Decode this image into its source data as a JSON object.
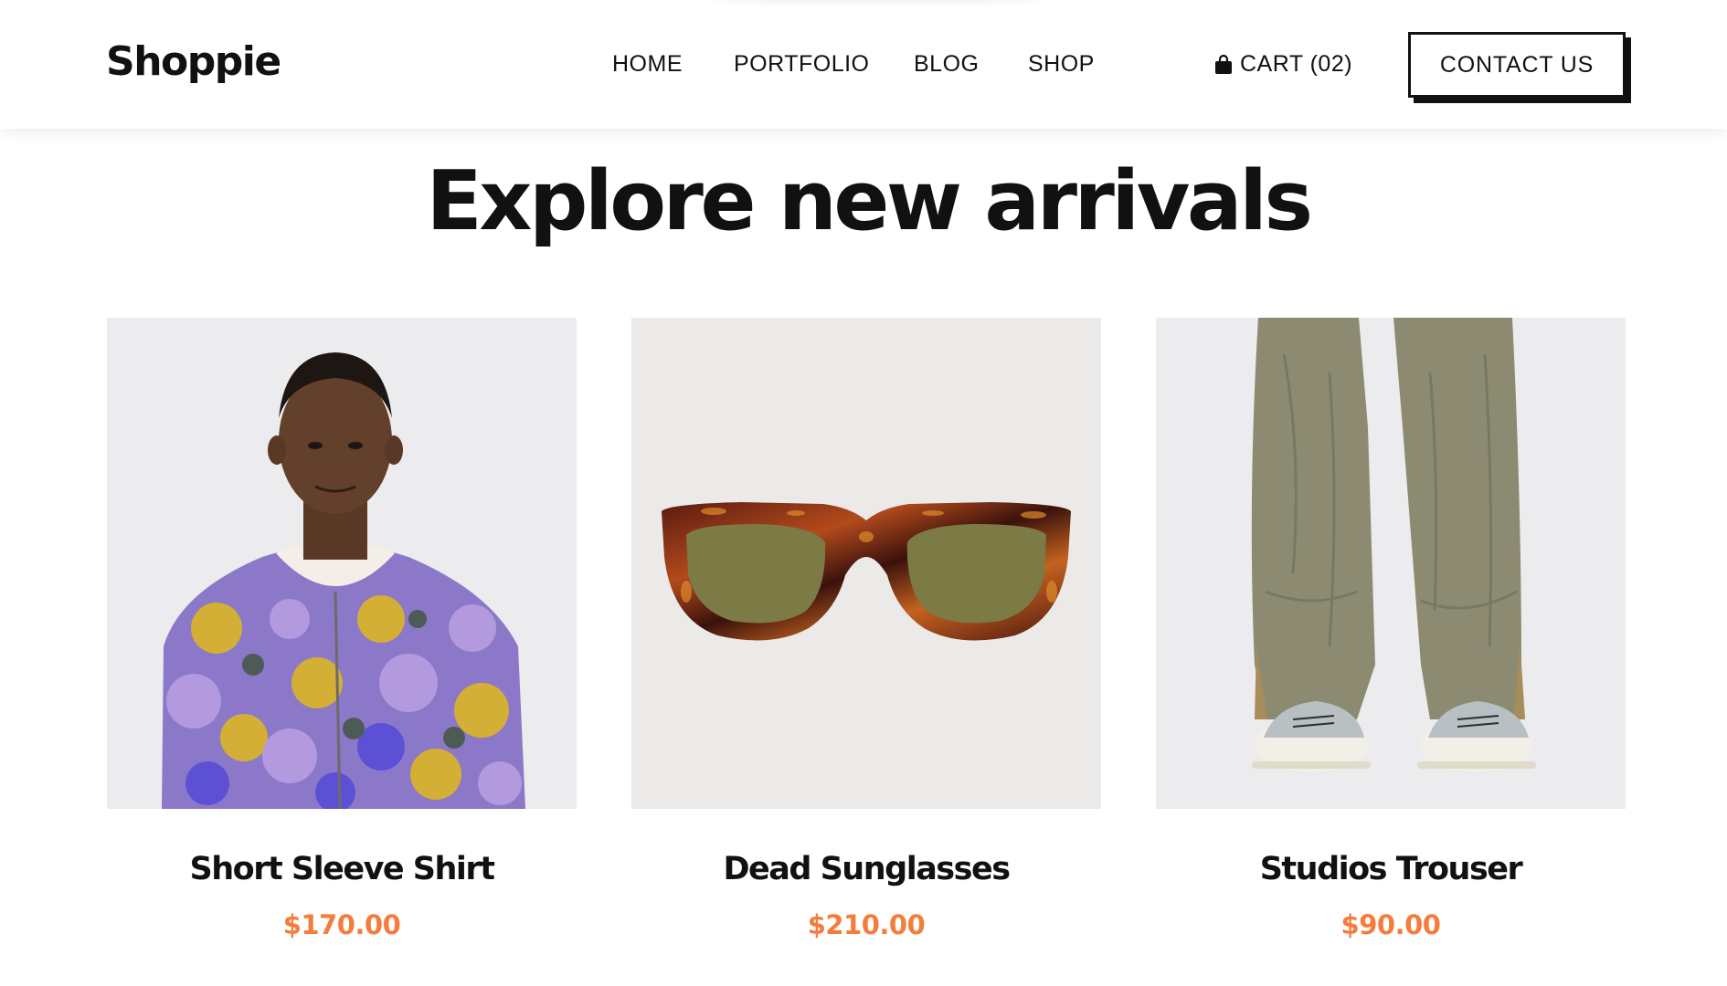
{
  "brand": {
    "logo_text": "Shoppie"
  },
  "nav": {
    "items": [
      {
        "label": "HOME"
      },
      {
        "label": "PORTFOLIO"
      },
      {
        "label": "BLOG"
      },
      {
        "label": "SHOP"
      }
    ],
    "cart_label": "CART (02)",
    "contact_label": "CONTACT US"
  },
  "section": {
    "title": "Explore new arrivals"
  },
  "products": [
    {
      "name": "Short Sleeve Shirt",
      "price": "$170.00"
    },
    {
      "name": "Dead Sunglasses",
      "price": "$210.00"
    },
    {
      "name": "Studios Trouser",
      "price": "$90.00"
    }
  ],
  "colors": {
    "price": "#f47c3c",
    "text": "#111111",
    "card_bg_1": "#ececee",
    "card_bg_2": "#ebeae8",
    "card_bg_3": "#ececee"
  },
  "icons": {
    "cart": "shopping-bag-icon"
  }
}
